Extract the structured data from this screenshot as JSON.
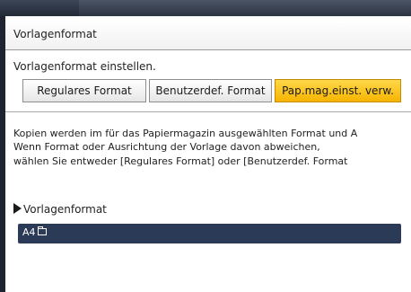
{
  "dialog": {
    "title": "Vorlagenformat",
    "instruction": "Vorlagenformat einstellen."
  },
  "buttons": {
    "regular": "Regulares Format",
    "custom": "Benutzerdef. Format",
    "paper_tray": "Pap.mag.einst. verw."
  },
  "selected_button": "paper_tray",
  "description": {
    "line1": "Kopien werden im für das Papiermagazin ausgewählten Format und A",
    "line2": "Wenn Format oder Ausrichtung der Vorlage davon abweichen,",
    "line3": "wählen Sie entweder [Regulares Format] oder [Benutzerdef. Format"
  },
  "section": {
    "label": "Vorlagenformat",
    "value": "A4",
    "value_icon": "paper-orientation-icon"
  },
  "colors": {
    "selected_button": "#f6b400",
    "value_bar": "#2b3a56"
  }
}
